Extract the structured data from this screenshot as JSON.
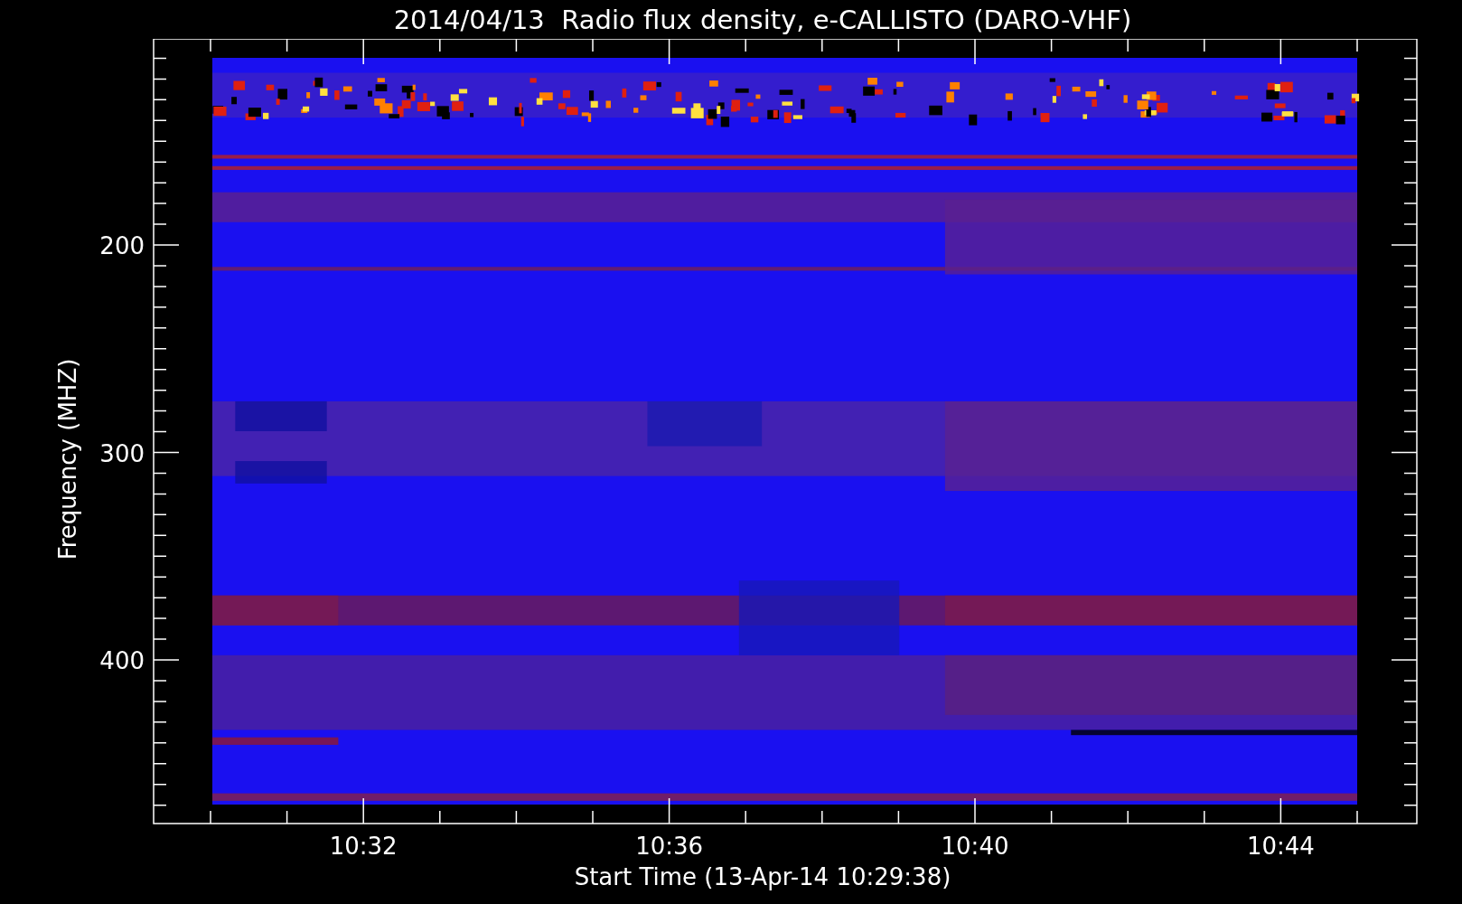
{
  "title": "2014/04/13  Radio flux density, e-CALLISTO (DARO-VHF)",
  "y_axis": {
    "label": "Frequency (MHZ)",
    "ticks": [
      "200",
      "300",
      "400"
    ]
  },
  "x_axis": {
    "label": "Start Time (13-Apr-14 10:29:38)",
    "ticks": [
      "10:32",
      "10:36",
      "10:40",
      "10:44"
    ]
  }
}
